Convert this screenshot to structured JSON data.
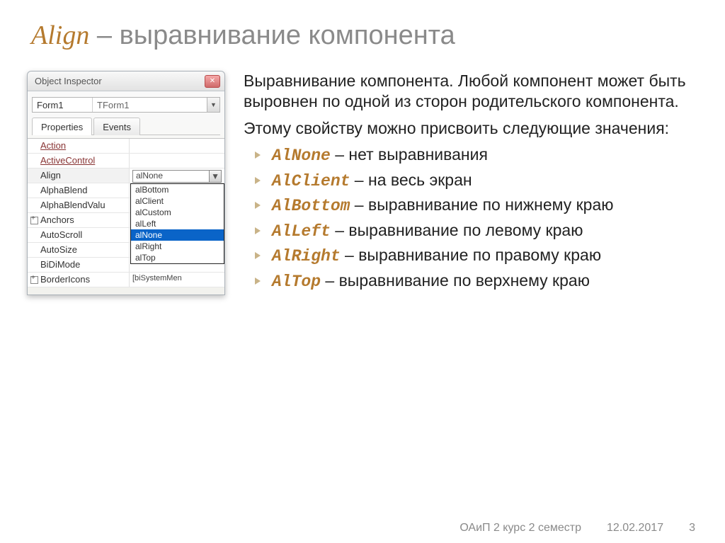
{
  "title": {
    "word": "Align",
    "dash": "–",
    "rest": "выравнивание компонента"
  },
  "inspector": {
    "window_title": "Object Inspector",
    "selector": {
      "name": "Form1",
      "type": "TForm1"
    },
    "tabs": {
      "props": "Properties",
      "events": "Events"
    },
    "rows": [
      {
        "name": "Action",
        "val": "",
        "link": true
      },
      {
        "name": "ActiveControl",
        "val": "",
        "link": true
      },
      {
        "name": "Align",
        "val": "alNone",
        "combo": true
      },
      {
        "name": "AlphaBlend",
        "val": "",
        "dropdownCovered": true
      },
      {
        "name": "AlphaBlendValu",
        "val": ""
      },
      {
        "name": "Anchors",
        "val": "",
        "exp": true
      },
      {
        "name": "AutoScroll",
        "val": ""
      },
      {
        "name": "AutoSize",
        "val": ""
      },
      {
        "name": "BiDiMode",
        "val": ""
      },
      {
        "name": "BorderIcons",
        "val": "[biSystemMen",
        "exp": true,
        "faint": true
      }
    ],
    "dropdown": [
      "alBottom",
      "alClient",
      "alCustom",
      "alLeft",
      "alNone",
      "alRight",
      "alTop"
    ],
    "dropdown_selected": "alNone"
  },
  "body": {
    "p1": "Выравнивание компонента. Любой компонент может быть выровнен по одной из сторон родительского компонента.",
    "p2": "Этому свойству можно присвоить следующие значения:",
    "items": [
      {
        "code": "AlNone",
        "text": " – нет выравнивания"
      },
      {
        "code": "AlClient",
        "text": " – на весь экран"
      },
      {
        "code": "AlBottom",
        "text": " – выравнивание по нижнему краю"
      },
      {
        "code": "AlLeft",
        "text": " – выравнивание по левому краю"
      },
      {
        "code": "AlRight",
        "text": " – выравнивание по правому краю"
      },
      {
        "code": "AlTop",
        "text": " – выравнивание по верхнему краю"
      }
    ]
  },
  "footer": {
    "course": "ОАиП 2 курс 2 семестр",
    "date": "12.02.2017",
    "page": "3"
  }
}
